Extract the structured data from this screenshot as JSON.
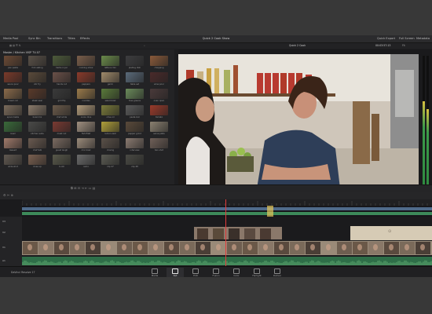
{
  "app": {
    "title": "Quick 2 Cook Show",
    "topbar": [
      "Media Pool",
      "Sync Bin",
      "Transitions",
      "Titles",
      "Effects"
    ],
    "topbar_right": [
      "Quick Export",
      "Full Screen",
      "Metadata"
    ]
  },
  "media_pool": {
    "bin_label": "Master / Kitchen VISP TV-07",
    "clips": [
      {
        "name": "pan pasta",
        "color": "#6b4a35"
      },
      {
        "name": "fork eating",
        "color": "#5a5148"
      },
      {
        "name": "herbs in jar",
        "color": "#4d5a3a"
      },
      {
        "name": "cooking show",
        "color": "#7a5e4a"
      },
      {
        "name": "lettuce mix",
        "color": "#6a8a4a"
      },
      {
        "name": "plating dish",
        "color": "#3d3d3f"
      },
      {
        "name": "chopping",
        "color": "#8a5a3a"
      },
      {
        "name": "sauce pour",
        "color": "#7a3a2a"
      },
      {
        "name": "stir fry",
        "color": "#5a4a3a"
      },
      {
        "name": "hands cut",
        "color": "#6a5048"
      },
      {
        "name": "peppers",
        "color": "#8a3a2a"
      },
      {
        "name": "garlic",
        "color": "#a08a6a"
      },
      {
        "name": "table set",
        "color": "#5a6a7a"
      },
      {
        "name": "wine pour",
        "color": "#4a2a2a"
      },
      {
        "name": "bread cut",
        "color": "#8a6a4a"
      },
      {
        "name": "steak sear",
        "color": "#5a3a2a"
      },
      {
        "name": "grill flip",
        "color": "#3a3a3a"
      },
      {
        "name": "noodles",
        "color": "#9a7a4a"
      },
      {
        "name": "salad bowl",
        "color": "#5a7a3a"
      },
      {
        "name": "toss greens",
        "color": "#6a8a5a"
      },
      {
        "name": "oven open",
        "color": "#4a3a3a"
      },
      {
        "name": "spoon taste",
        "color": "#7a6a5a"
      },
      {
        "name": "bowl mix",
        "color": "#8a7a6a"
      },
      {
        "name": "chef smile",
        "color": "#6a5a4a"
      },
      {
        "name": "onion dice",
        "color": "#b09a7a"
      },
      {
        "name": "olive oil",
        "color": "#7a7a3a"
      },
      {
        "name": "pasta boil",
        "color": "#5a5a5a"
      },
      {
        "name": "tomato",
        "color": "#9a3a2a"
      },
      {
        "name": "basil",
        "color": "#3a6a3a"
      },
      {
        "name": "kitchen wide",
        "color": "#4a4a48"
      },
      {
        "name": "meat cut",
        "color": "#7a3a32"
      },
      {
        "name": "fish fillet",
        "color": "#a09080"
      },
      {
        "name": "lemon zest",
        "color": "#b0a03a"
      },
      {
        "name": "pepper grind",
        "color": "#5a4a3a"
      },
      {
        "name": "serve plate",
        "color": "#8a8070"
      },
      {
        "name": "dessert",
        "color": "#a07a6a"
      },
      {
        "name": "chef talk",
        "color": "#6a5a50"
      },
      {
        "name": "guest laugh",
        "color": "#7a6a60"
      },
      {
        "name": "mix bowl",
        "color": "#9a8a7a"
      },
      {
        "name": "closing",
        "color": "#5a5048"
      },
      {
        "name": "interview",
        "color": "#8a7a70"
      },
      {
        "name": "two shot",
        "color": "#706058"
      },
      {
        "name": "wide shot",
        "color": "#605850"
      },
      {
        "name": "close up",
        "color": "#7a6050"
      },
      {
        "name": "b-roll",
        "color": "#58584a"
      },
      {
        "name": "outro",
        "color": "#6a6a6a"
      },
      {
        "name": "clip 47",
        "color": "#5a5a52"
      },
      {
        "name": "clip 48",
        "color": "#4a4a44"
      }
    ]
  },
  "viewer": {
    "clip_name": "Quick 2 Cook",
    "zoom": "Fit",
    "timecode_top": "00:03:57:13",
    "timecode": "00:58:57:11"
  },
  "timeline": {
    "timecode": "01:00:35:11",
    "tracks": [
      {
        "name": "V3"
      },
      {
        "name": "V2"
      },
      {
        "name": "V1"
      },
      {
        "name": "A1"
      }
    ]
  },
  "pages": [
    {
      "label": "Media",
      "active": false
    },
    {
      "label": "Cut",
      "active": true
    },
    {
      "label": "Edit",
      "active": false
    },
    {
      "label": "Fusion",
      "active": false
    },
    {
      "label": "Color",
      "active": false
    },
    {
      "label": "Fairlight",
      "active": false
    },
    {
      "label": "Deliver",
      "active": false
    }
  ],
  "footer": {
    "product": "DaVinci Resolve 17"
  },
  "colors": {
    "accent": "#e23b3b",
    "video_track": "#4f6a8a",
    "audio_track": "#3d8a5a"
  }
}
